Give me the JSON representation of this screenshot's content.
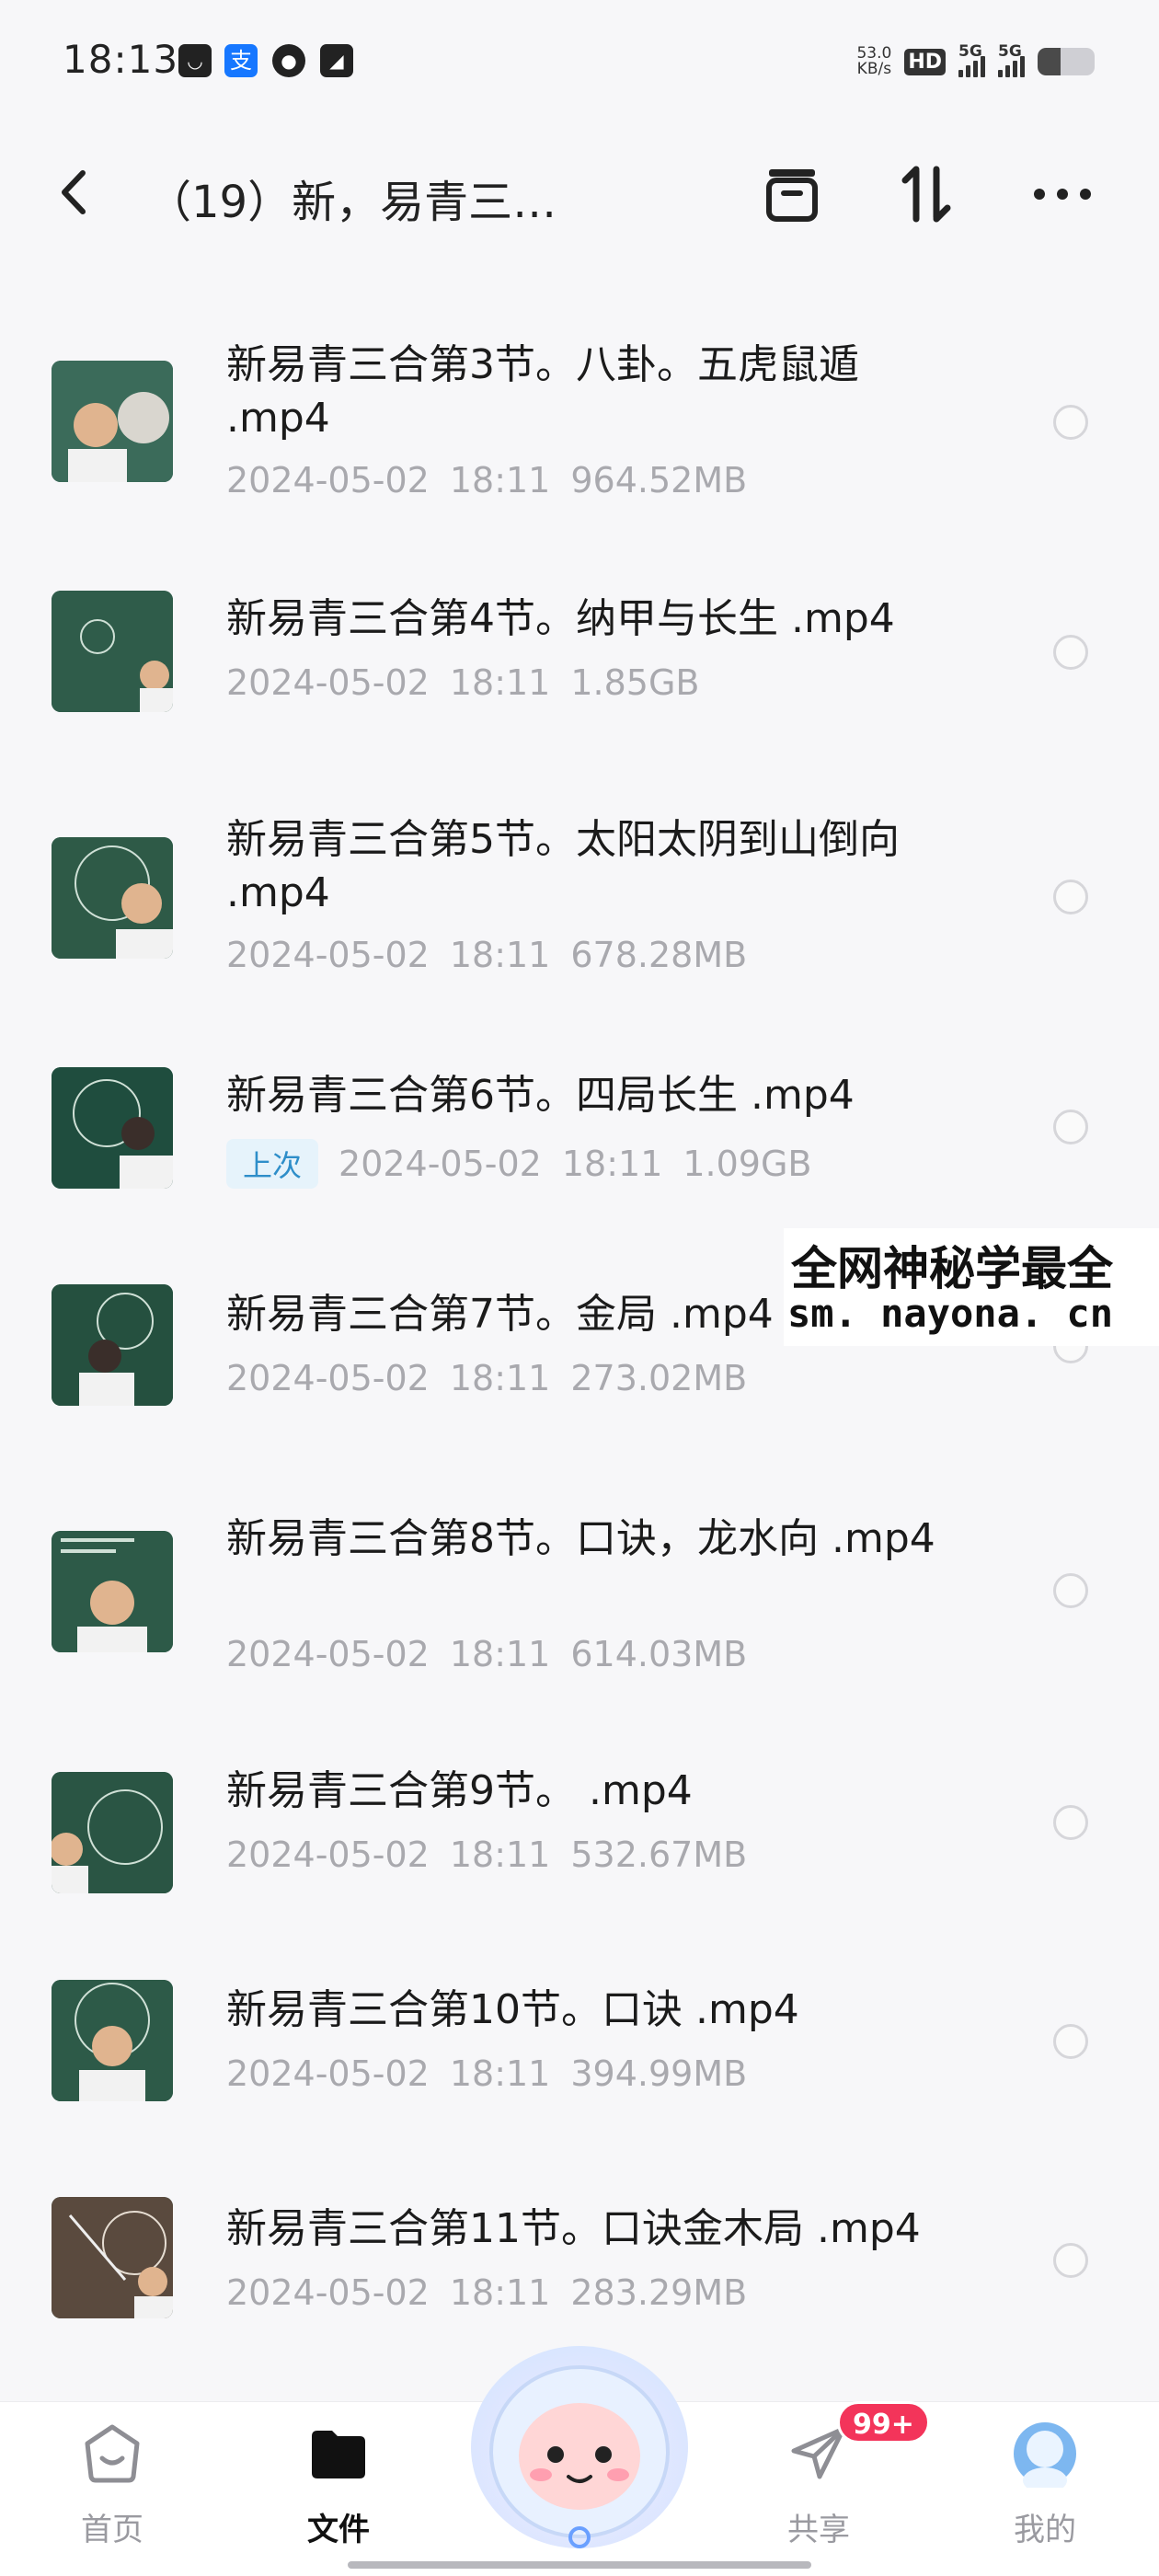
{
  "status_bar": {
    "time": "18:13",
    "net_speed_value": "53.0",
    "net_speed_unit": "KB/s",
    "hd_label": "HD",
    "sim1_network": "5G",
    "sim2_network": "5G",
    "battery_level": 0.4,
    "app_icons": [
      "notification-app-icon",
      "alipay-icon",
      "wechat-icon",
      "message-app-icon"
    ]
  },
  "header": {
    "title": "（19）新，易青三…",
    "icons": [
      "back-arrow-icon",
      "archive-icon",
      "sort-icon",
      "more-icon"
    ]
  },
  "files": [
    {
      "name": "新易青三合第3节。八卦。五虎鼠遁 .mp4",
      "date": "2024-05-02",
      "time": "18:11",
      "size": "964.52MB"
    },
    {
      "name": "新易青三合第4节。纳甲与长生 .mp4",
      "date": "2024-05-02",
      "time": "18:11",
      "size": "1.85GB"
    },
    {
      "name": "新易青三合第5节。太阳太阴到山倒向 .mp4",
      "date": "2024-05-02",
      "time": "18:11",
      "size": "678.28MB"
    },
    {
      "name": "新易青三合第6节。四局长生 .mp4",
      "badge": "上次",
      "date": "2024-05-02",
      "time": "18:11",
      "size": "1.09GB"
    },
    {
      "name": "新易青三合第7节。金局 .mp4",
      "date": "2024-05-02",
      "time": "18:11",
      "size": "273.02MB"
    },
    {
      "name": "新易青三合第8节。口诀，龙水向 .mp4",
      "date": "2024-05-02",
      "time": "18:11",
      "size": "614.03MB"
    },
    {
      "name": "新易青三合第9节。 .mp4",
      "date": "2024-05-02",
      "time": "18:11",
      "size": "532.67MB"
    },
    {
      "name": "新易青三合第10节。口诀 .mp4",
      "date": "2024-05-02",
      "time": "18:11",
      "size": "394.99MB"
    },
    {
      "name": "新易青三合第11节。口诀金木局 .mp4",
      "date": "2024-05-02",
      "time": "18:11",
      "size": "283.29MB"
    }
  ],
  "watermark": {
    "line1": "全网神秘学最全",
    "line2": "sm. nayona. cn"
  },
  "bottom_nav": {
    "items": [
      {
        "label": "首页",
        "icon": "home-icon"
      },
      {
        "label": "文件",
        "icon": "folder-icon",
        "active": true
      },
      {
        "label": "共享",
        "icon": "share-icon"
      },
      {
        "label": "我的",
        "icon": "profile-icon"
      }
    ],
    "share_badge": "99+"
  },
  "colors": {
    "background": "#f7f7f9",
    "badge_red": "#f3345a",
    "last_badge_bg": "#e6f3fb",
    "last_badge_text": "#2e8ec9",
    "meta_gray": "#a9a9ae",
    "chalkboard_green": "#2d5a48"
  }
}
